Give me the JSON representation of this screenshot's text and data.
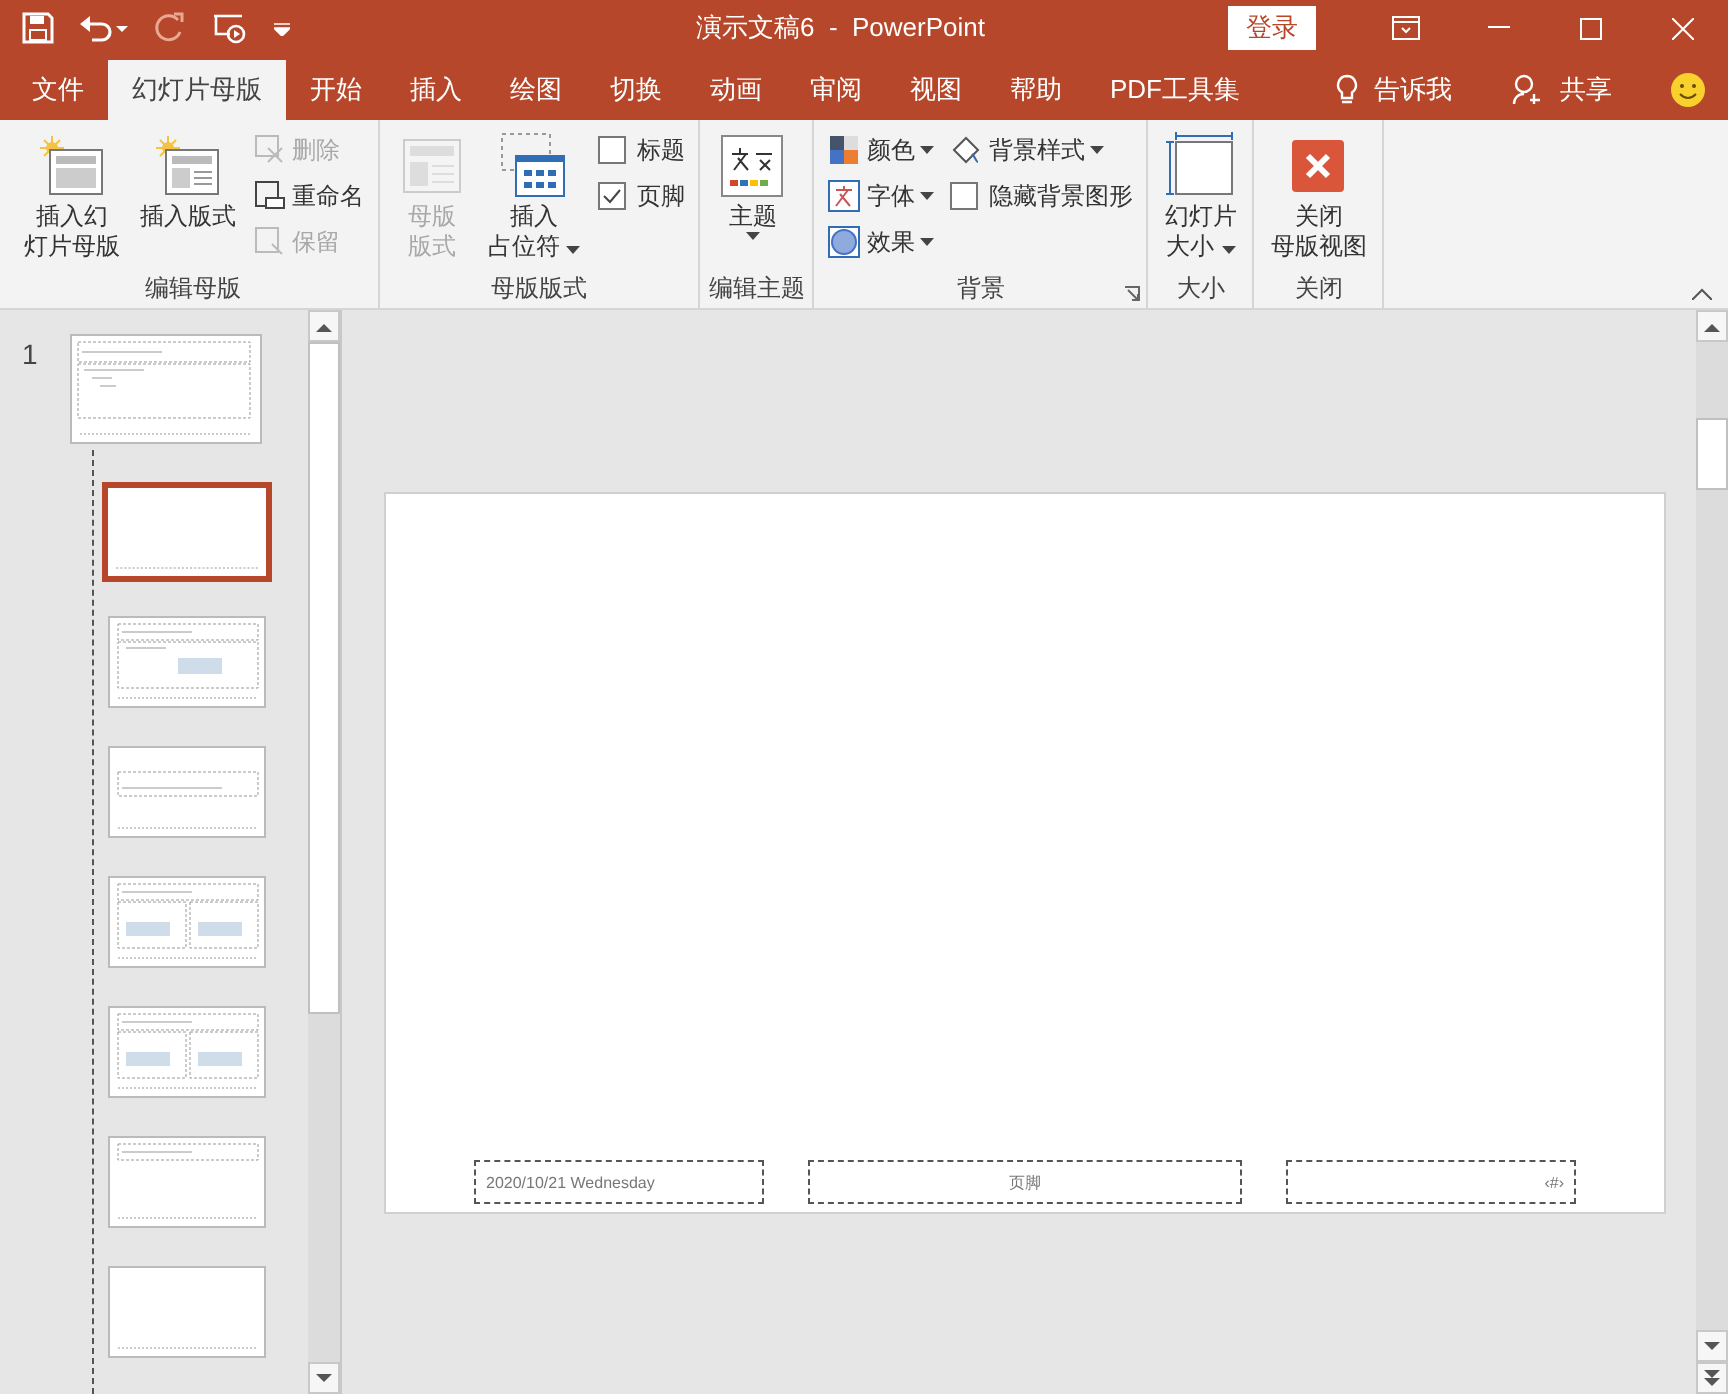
{
  "title_bar": {
    "title": "演示文稿6  -  PowerPoint",
    "login": "登录"
  },
  "tabs": [
    {
      "label": "文件",
      "selected": false
    },
    {
      "label": "幻灯片母版",
      "selected": true
    },
    {
      "label": "开始",
      "selected": false
    },
    {
      "label": "插入",
      "selected": false
    },
    {
      "label": "绘图",
      "selected": false
    },
    {
      "label": "切换",
      "selected": false
    },
    {
      "label": "动画",
      "selected": false
    },
    {
      "label": "审阅",
      "selected": false
    },
    {
      "label": "视图",
      "selected": false
    },
    {
      "label": "帮助",
      "selected": false
    },
    {
      "label": "PDF工具集",
      "selected": false
    }
  ],
  "tell_me": "告诉我",
  "share": "共享",
  "ribbon": [
    {
      "label": "编辑母版",
      "items": [
        {
          "kind": "large",
          "lines": [
            "插入幻",
            "灯片母版"
          ],
          "disabled": false,
          "dropdown": false
        },
        {
          "kind": "large",
          "lines": [
            "插入版式"
          ],
          "disabled": false,
          "dropdown": false
        },
        {
          "kind": "stack",
          "items": [
            {
              "kind": "small",
              "label": "删除",
              "disabled": true,
              "dropdown": false
            },
            {
              "kind": "small",
              "label": "重命名",
              "disabled": false,
              "dropdown": false
            },
            {
              "kind": "small",
              "label": "保留",
              "disabled": true,
              "dropdown": false
            }
          ]
        }
      ]
    },
    {
      "label": "母版版式",
      "items": [
        {
          "kind": "large",
          "lines": [
            "母版",
            "版式"
          ],
          "disabled": true,
          "dropdown": false
        },
        {
          "kind": "large",
          "lines": [
            "插入",
            "占位符"
          ],
          "disabled": false,
          "dropdown": true
        },
        {
          "kind": "stack",
          "items": [
            {
              "kind": "checkbox",
              "label": "标题",
              "checked": false
            },
            {
              "kind": "checkbox",
              "label": "页脚",
              "checked": true
            }
          ]
        }
      ]
    },
    {
      "label": "编辑主题",
      "items": [
        {
          "kind": "large",
          "lines": [
            "主题"
          ],
          "disabled": false,
          "dropdown": true
        }
      ]
    },
    {
      "label": "背景",
      "launcher": true,
      "items": [
        {
          "kind": "stack",
          "items": [
            {
              "kind": "small",
              "label": "颜色",
              "disabled": false,
              "dropdown": true
            },
            {
              "kind": "small",
              "label": "字体",
              "disabled": false,
              "dropdown": true
            },
            {
              "kind": "small",
              "label": "效果",
              "disabled": false,
              "dropdown": true
            }
          ]
        },
        {
          "kind": "stack",
          "items": [
            {
              "kind": "small",
              "label": "背景样式",
              "disabled": false,
              "dropdown": true
            },
            {
              "kind": "checkbox",
              "label": "隐藏背景图形",
              "checked": false
            }
          ]
        }
      ]
    },
    {
      "label": "大小",
      "items": [
        {
          "kind": "large",
          "lines": [
            "幻灯片",
            "大小"
          ],
          "disabled": false,
          "dropdown": true
        }
      ]
    },
    {
      "label": "关闭",
      "items": [
        {
          "kind": "large",
          "lines": [
            "关闭",
            "母版视图"
          ],
          "disabled": false,
          "dropdown": false
        }
      ]
    }
  ],
  "thumbnails": {
    "number": "1",
    "master": {
      "selected": false
    },
    "layouts": [
      {
        "kind": "title",
        "selected": true
      },
      {
        "kind": "content",
        "selected": false
      },
      {
        "kind": "section",
        "selected": false
      },
      {
        "kind": "two",
        "selected": false
      },
      {
        "kind": "compare",
        "selected": false
      },
      {
        "kind": "titleonly",
        "selected": false
      },
      {
        "kind": "blank",
        "selected": false
      }
    ]
  },
  "slide": {
    "date": "2020/10/21 Wednesday",
    "footer": "页脚",
    "number": "‹#›"
  }
}
